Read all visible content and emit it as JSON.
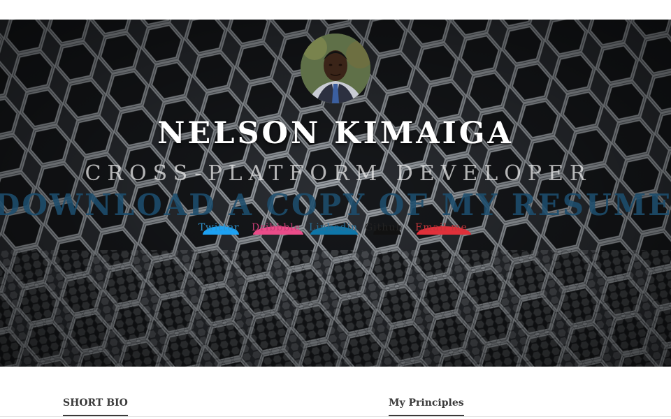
{
  "hero": {
    "name": "NELSON KIMAIGA",
    "role": "CROSS-PLATFORM DEVELOPER",
    "resume_link": "DOWNLOAD A COPY OF MY RESUME"
  },
  "social": [
    {
      "label": "Twitter",
      "color": "#1da1f2",
      "icon": "twitter-icon"
    },
    {
      "label": "Dribbble",
      "color": "#ea4c89",
      "icon": "dribbble-icon"
    },
    {
      "label": "Linkedin",
      "color": "#0e76a8",
      "icon": "linkedin-icon"
    },
    {
      "label": "Github",
      "color": "#111111",
      "icon": "github-icon"
    },
    {
      "label": "Email me",
      "color": "#e0303a",
      "icon": "email-icon"
    }
  ],
  "sections": {
    "bio_title": "SHORT BIO",
    "principles_title": "My Principles"
  },
  "colors": {
    "hero_text": "#ffffff",
    "resume_link": "#1d4e6e",
    "heading": "#3a3a3a"
  }
}
